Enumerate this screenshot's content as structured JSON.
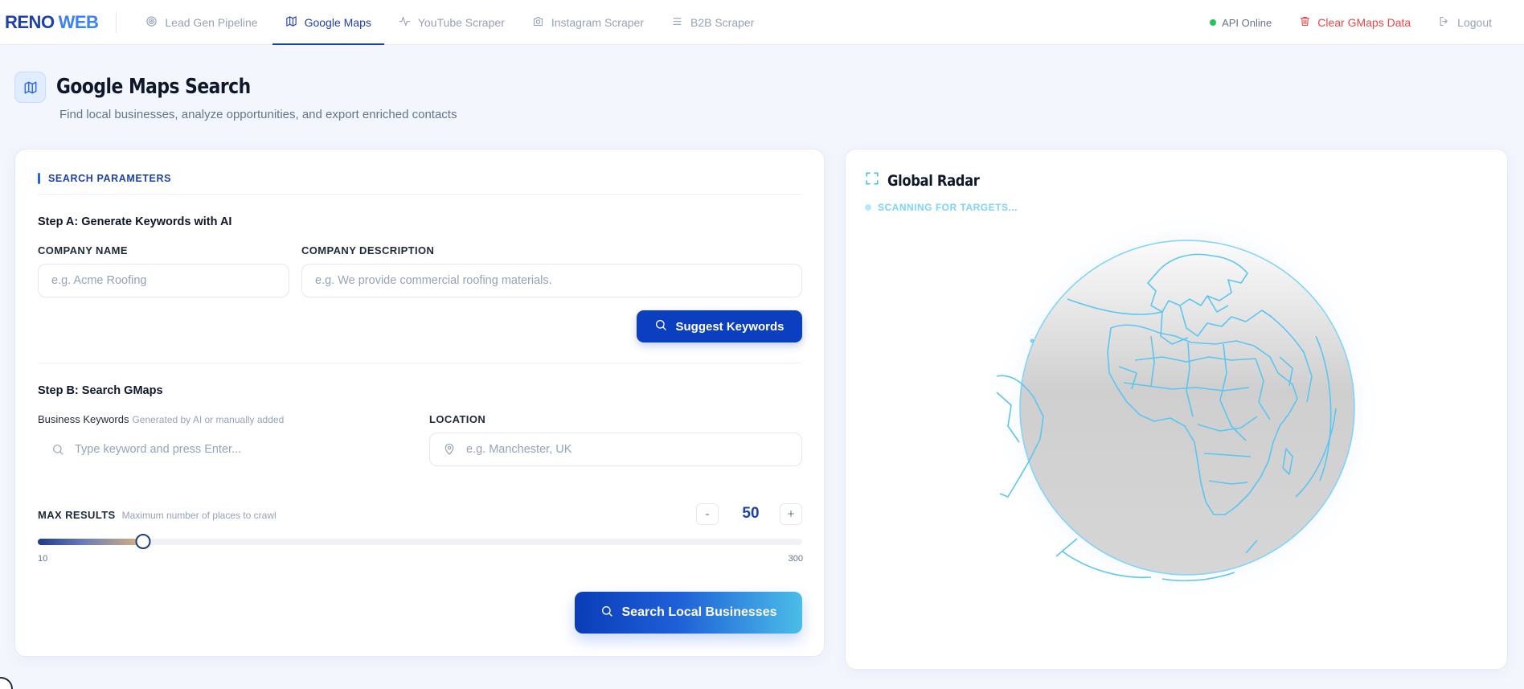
{
  "brand": {
    "part1": "RENO",
    "part2": "WEB"
  },
  "nav": {
    "tabs": [
      {
        "label": "Lead Gen Pipeline",
        "icon": "target-icon",
        "active": false
      },
      {
        "label": "Google Maps",
        "icon": "map-icon",
        "active": true
      },
      {
        "label": "YouTube Scraper",
        "icon": "activity-icon",
        "active": false
      },
      {
        "label": "Instagram Scraper",
        "icon": "camera-icon",
        "active": false
      },
      {
        "label": "B2B Scraper",
        "icon": "list-icon",
        "active": false
      }
    ],
    "api_status": "API Online",
    "clear_label": "Clear GMaps Data",
    "logout_label": "Logout"
  },
  "header": {
    "title": "Google Maps Search",
    "subtitle": "Find local businesses, analyze opportunities, and export enriched contacts"
  },
  "search": {
    "section_title": "SEARCH PARAMETERS",
    "step_a": "Step A: Generate Keywords with AI",
    "company_name_label": "COMPANY NAME",
    "company_name_placeholder": "e.g. Acme Roofing",
    "company_desc_label": "COMPANY DESCRIPTION",
    "company_desc_placeholder": "e.g. We provide commercial roofing materials.",
    "suggest_button": "Suggest Keywords",
    "step_b": "Step B: Search GMaps",
    "keywords_label": "Business Keywords",
    "keywords_hint": "Generated by AI or manually added",
    "keywords_placeholder": "Type keyword and press Enter...",
    "location_label": "LOCATION",
    "location_placeholder": "e.g. Manchester, UK",
    "max_results_label": "MAX RESULTS",
    "max_results_hint": "Maximum number of places to crawl",
    "max_results_value": "50",
    "minus": "-",
    "plus": "+",
    "range_min": "10",
    "range_max": "300",
    "slider_value": 50,
    "slider_min": 10,
    "slider_max": 300,
    "search_button": "Search Local Businesses"
  },
  "radar": {
    "title": "Global Radar",
    "status": "SCANNING FOR TARGETS..."
  },
  "colors": {
    "primary": "#1e40af",
    "accent": "#38bdf8",
    "danger": "#ef4444",
    "online": "#22c55e"
  }
}
